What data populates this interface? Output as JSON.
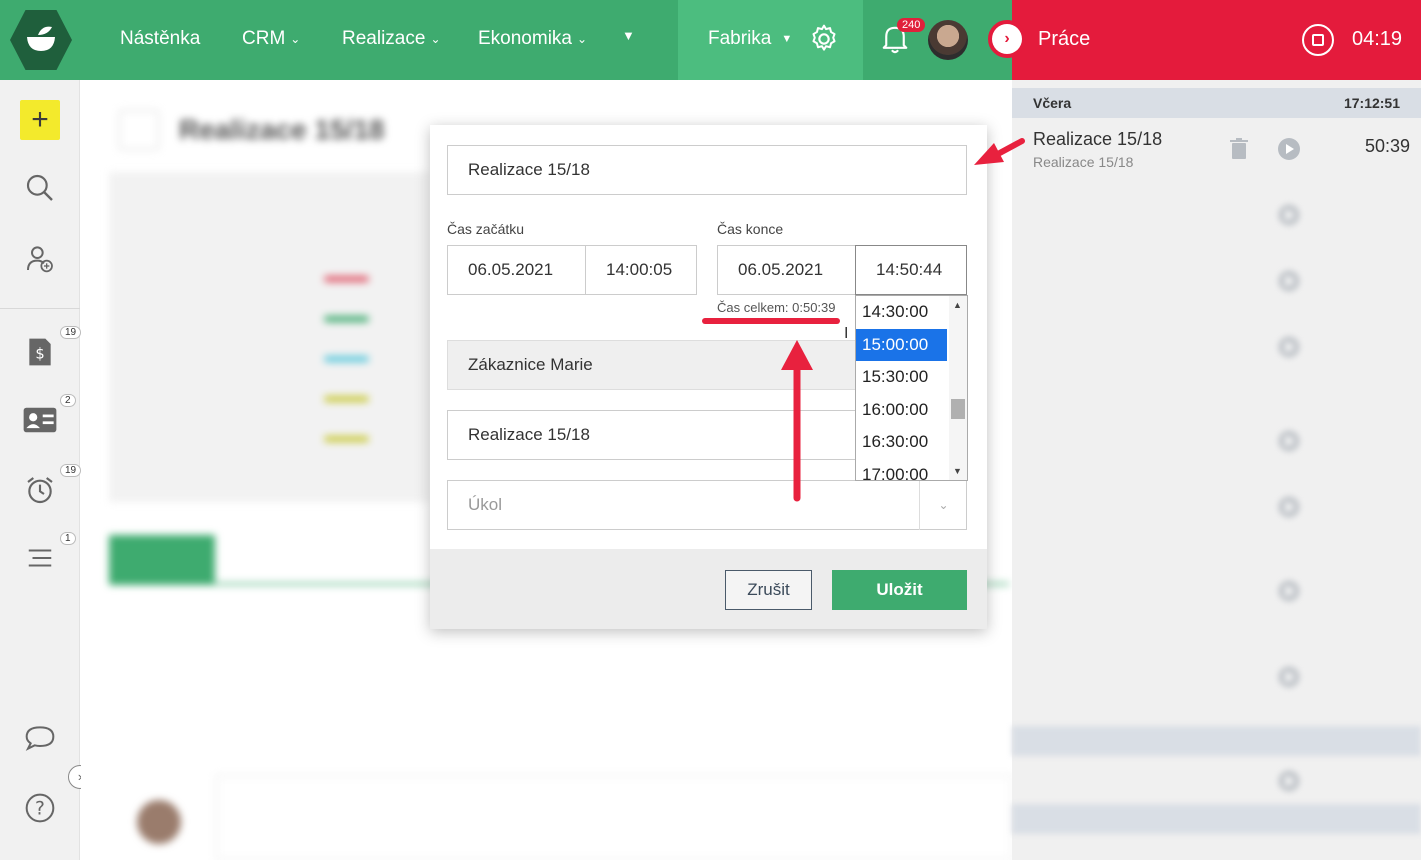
{
  "nav": {
    "items": [
      {
        "label": "Nástěnka",
        "dropdown": false
      },
      {
        "label": "CRM",
        "dropdown": true
      },
      {
        "label": "Realizace",
        "dropdown": true
      },
      {
        "label": "Ekonomika",
        "dropdown": true
      }
    ],
    "workspace": "Fabrika",
    "notifications_count": "240"
  },
  "work_panel": {
    "title": "Práce",
    "timer": "04:19",
    "day_label": "Včera",
    "day_total": "17:12:51",
    "active_entry": {
      "title": "Realizace 15/18",
      "subtitle": "Realizace 15/18",
      "duration": "50:39"
    }
  },
  "sidebar": {
    "badges": {
      "invoices": "19",
      "contacts": "2",
      "reminders": "19",
      "tasks": "1"
    }
  },
  "modal": {
    "title_value": "Realizace 15/18",
    "start_label": "Čas začátku",
    "start_date": "06.05.2021",
    "start_time": "14:00:05",
    "end_label": "Čas konce",
    "end_date": "06.05.2021",
    "end_time": "14:50:44",
    "total": "Čas celkem: 0:50:39",
    "customer": "Zákaznice Marie",
    "project": "Realizace 15/18",
    "task_placeholder": "Úkol",
    "time_options": [
      "14:30:00",
      "15:00:00",
      "15:30:00",
      "16:00:00",
      "16:30:00",
      "17:00:00"
    ],
    "selected_option": "15:00:00",
    "cancel_label": "Zrušit",
    "save_label": "Uložit"
  },
  "colors": {
    "green": "#3eab6f",
    "red": "#e41b3c",
    "highlight": "#1a73e8"
  }
}
